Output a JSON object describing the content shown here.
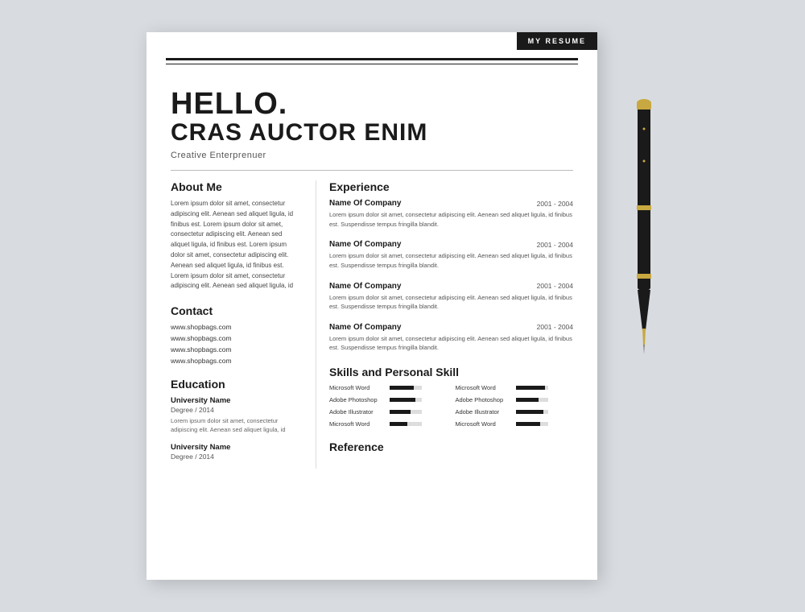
{
  "badge": "MY RESUME",
  "hello": "HELLO.",
  "name": "CRAS AUCTOR ENIM",
  "tagline": "Creative Enterprenuer",
  "left": {
    "about_title": "About Me",
    "about_text": "Lorem ipsum dolor sit amet, consectetur adipiscing elit. Aenean sed aliquet ligula, id finibus est. Lorem ipsum dolor sit amet, consectetur adipiscing elit. Aenean sed aliquet ligula, id finibus est. Lorem ipsum dolor sit amet, consectetur adipiscing elit. Aenean sed aliquet ligula, id finibus est. Lorem ipsum dolor sit amet, consectetur adipiscing elit. Aenean sed aliquet ligula, id",
    "contact_title": "Contact",
    "contacts": [
      "www.shopbags.com",
      "www.shopbags.com",
      "www.shopbags.com",
      "www.shopbags.com"
    ],
    "education_title": "Education",
    "education": [
      {
        "university": "University Name",
        "degree": "Degree / 2014",
        "desc": "Lorem ipsum dolor sit amet, consectetur adipiscing elit. Aenean sed aliquet ligula, id"
      },
      {
        "university": "University Name",
        "degree": "Degree / 2014",
        "desc": ""
      }
    ]
  },
  "right": {
    "experience_title": "Experience",
    "experiences": [
      {
        "company": "Name Of Company",
        "dates": "2001 - 2004",
        "desc": "Lorem ipsum dolor sit amet, consectetur adipiscing elit. Aenean sed aliquet ligula, id finibus est. Suspendisse tempus fringilla blandit."
      },
      {
        "company": "Name Of Company",
        "dates": "2001 - 2004",
        "desc": "Lorem ipsum dolor sit amet, consectetur adipiscing elit. Aenean sed aliquet ligula, id finibus est. Suspendisse tempus fringilla blandit."
      },
      {
        "company": "Name Of Company",
        "dates": "2001 - 2004",
        "desc": "Lorem ipsum dolor sit amet, consectetur adipiscing elit. Aenean sed aliquet ligula, id finibus est. Suspendisse tempus fringilla blandit."
      },
      {
        "company": "Name Of Company",
        "dates": "2001 - 2004",
        "desc": "Lorem ipsum dolor sit amet, consectetur adipiscing elit. Aenean sed aliquet ligula, id finibus est. Suspendisse tempus fringilla blandit."
      }
    ],
    "skills_title": "Skills and Personal Skill",
    "skills": [
      {
        "label": "Microsoft  Word",
        "pct": 75
      },
      {
        "label": "Microsoft  Word",
        "pct": 90
      },
      {
        "label": "Adobe Photoshop",
        "pct": 80
      },
      {
        "label": "Adobe Photoshop",
        "pct": 70
      },
      {
        "label": "Adobe Illustrator",
        "pct": 65
      },
      {
        "label": "Adobe Illustrator",
        "pct": 85
      },
      {
        "label": "Microsoft  Word",
        "pct": 55
      },
      {
        "label": "Microsoft  Word",
        "pct": 75
      }
    ],
    "reference_title": "Reference"
  }
}
